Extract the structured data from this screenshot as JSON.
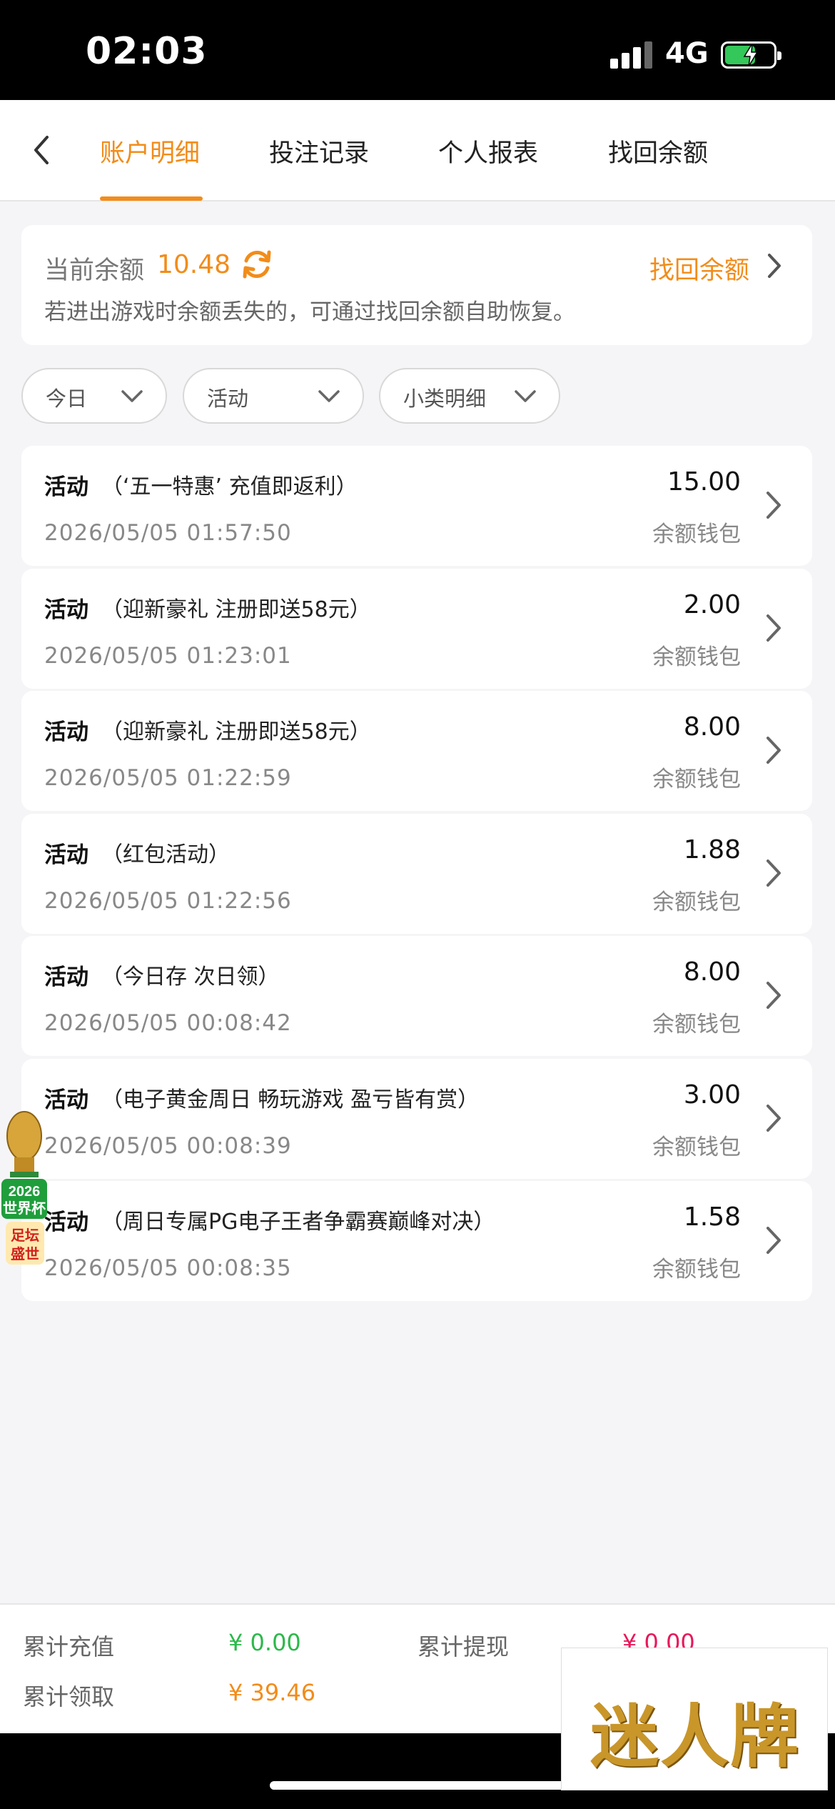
{
  "status_bar": {
    "time": "02:03",
    "network": "4G"
  },
  "header": {
    "tabs": [
      {
        "label": "账户明细"
      },
      {
        "label": "投注记录"
      },
      {
        "label": "个人报表"
      },
      {
        "label": "找回余额"
      }
    ]
  },
  "balance": {
    "label": "当前余额",
    "value": "10.48",
    "recover_label": "找回余额",
    "hint": "若进出游戏时余额丢失的，可通过找回余额自助恢复。"
  },
  "filters": [
    {
      "label": "今日"
    },
    {
      "label": "活动"
    },
    {
      "label": "小类明细"
    }
  ],
  "records": [
    {
      "type": "活动",
      "desc": "（‘五一特惠’ 充值即返利）",
      "time": "2026/05/05 01:57:50",
      "amount": "15.00",
      "wallet": "余额钱包"
    },
    {
      "type": "活动",
      "desc": "（迎新豪礼 注册即送58元）",
      "time": "2026/05/05 01:23:01",
      "amount": "2.00",
      "wallet": "余额钱包"
    },
    {
      "type": "活动",
      "desc": "（迎新豪礼 注册即送58元）",
      "time": "2026/05/05 01:22:59",
      "amount": "8.00",
      "wallet": "余额钱包"
    },
    {
      "type": "活动",
      "desc": "（红包活动）",
      "time": "2026/05/05 01:22:56",
      "amount": "1.88",
      "wallet": "余额钱包"
    },
    {
      "type": "活动",
      "desc": "（今日存 次日领）",
      "time": "2026/05/05 00:08:42",
      "amount": "8.00",
      "wallet": "余额钱包"
    },
    {
      "type": "活动",
      "desc": "（电子黄金周日 畅玩游戏 盈亏皆有赏）",
      "time": "2026/05/05 00:08:39",
      "amount": "3.00",
      "wallet": "余额钱包"
    },
    {
      "type": "活动",
      "desc": "（周日专属PG电子王者争霸赛巅峰对决）",
      "time": "2026/05/05 00:08:35",
      "amount": "1.58",
      "wallet": "余额钱包"
    }
  ],
  "float_badge": {
    "line1": "2026",
    "line2": "世界杯",
    "line3": "足坛",
    "line4": "盛世"
  },
  "footer": {
    "recharge_label": "累计充值",
    "recharge_value": "¥ 0.00",
    "withdraw_label": "累计提现",
    "withdraw_value": "¥ 0.00",
    "claim_label": "累计领取",
    "claim_value": "¥ 39.46"
  },
  "watermark": {
    "text": "迷人牌"
  },
  "colors": {
    "accent": "#f28c1a",
    "green": "#2db84b",
    "red": "#e6195a"
  }
}
